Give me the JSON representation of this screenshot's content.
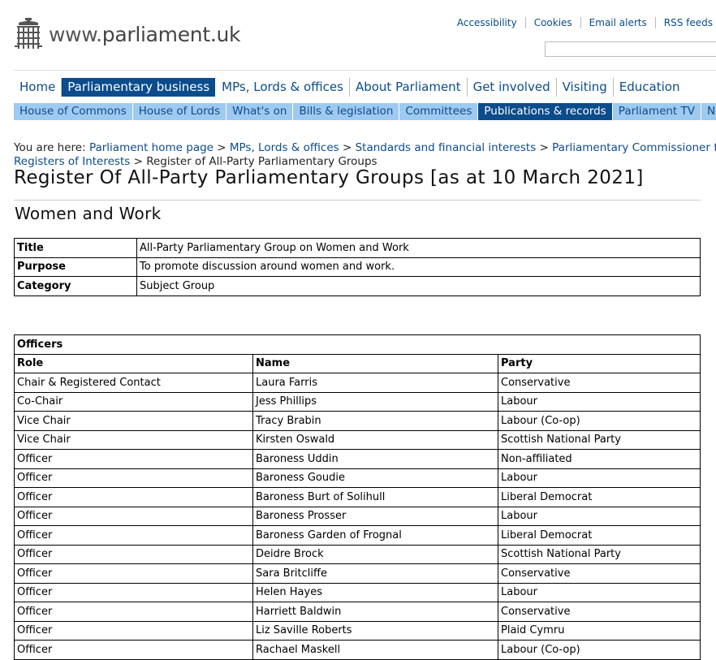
{
  "site": {
    "logo_text": "www.parliament.uk"
  },
  "toplinks": [
    "Accessibility",
    "Cookies",
    "Email alerts",
    "RSS feeds"
  ],
  "nav_primary": [
    {
      "label": "Home",
      "active": false
    },
    {
      "label": "Parliamentary business",
      "active": true
    },
    {
      "label": "MPs, Lords & offices",
      "active": false
    },
    {
      "label": "About Parliament",
      "active": false
    },
    {
      "label": "Get involved",
      "active": false
    },
    {
      "label": "Visiting",
      "active": false
    },
    {
      "label": "Education",
      "active": false
    }
  ],
  "nav_secondary": [
    {
      "label": "House of Commons",
      "active": false
    },
    {
      "label": "House of Lords",
      "active": false
    },
    {
      "label": "What's on",
      "active": false
    },
    {
      "label": "Bills & legislation",
      "active": false
    },
    {
      "label": "Committees",
      "active": false
    },
    {
      "label": "Publications & records",
      "active": true
    },
    {
      "label": "Parliament TV",
      "active": false
    },
    {
      "label": "News",
      "active": false
    }
  ],
  "breadcrumb": {
    "prefix": "You are here: ",
    "links": [
      "Parliament home page",
      "MPs, Lords & offices",
      "Standards and financial interests",
      "Parliamentary Commissioner for Standards",
      "Registers of Interests"
    ],
    "current": "Register of All-Party Parliamentary Groups"
  },
  "page_title": "Register Of All-Party Parliamentary Groups [as at 10 March 2021]",
  "group_name": "Women and Work",
  "info_table": [
    {
      "key": "Title",
      "value": "All-Party Parliamentary Group on Women and Work"
    },
    {
      "key": "Purpose",
      "value": "To promote discussion around women and work."
    },
    {
      "key": "Category",
      "value": "Subject Group"
    }
  ],
  "officers": {
    "heading": "Officers",
    "columns": [
      "Role",
      "Name",
      "Party"
    ],
    "rows": [
      [
        "Chair & Registered Contact",
        "Laura Farris",
        "Conservative"
      ],
      [
        "Co-Chair",
        "Jess Phillips",
        "Labour"
      ],
      [
        "Vice Chair",
        "Tracy Brabin",
        "Labour (Co-op)"
      ],
      [
        "Vice Chair",
        "Kirsten Oswald",
        "Scottish National Party"
      ],
      [
        "Officer",
        "Baroness Uddin",
        "Non-affiliated"
      ],
      [
        "Officer",
        "Baroness Goudie",
        "Labour"
      ],
      [
        "Officer",
        "Baroness Burt of Solihull",
        "Liberal Democrat"
      ],
      [
        "Officer",
        "Baroness Prosser",
        "Labour"
      ],
      [
        "Officer",
        "Baroness Garden of Frognal",
        "Liberal Democrat"
      ],
      [
        "Officer",
        "Deidre Brock",
        "Scottish National Party"
      ],
      [
        "Officer",
        "Sara Britcliffe",
        "Conservative"
      ],
      [
        "Officer",
        "Helen Hayes",
        "Labour"
      ],
      [
        "Officer",
        "Harriett Baldwin",
        "Conservative"
      ],
      [
        "Officer",
        "Liz Saville Roberts",
        "Plaid Cymru"
      ],
      [
        "Officer",
        "Rachael Maskell",
        "Labour (Co-op)"
      ]
    ]
  }
}
